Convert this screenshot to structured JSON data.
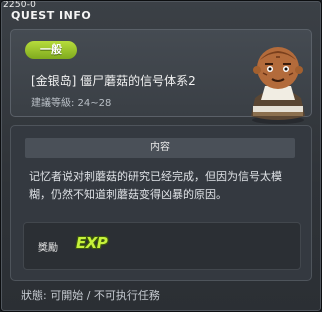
{
  "window": {
    "code": "2250-0",
    "title": "QUEST INFO"
  },
  "quest": {
    "category": "一般",
    "title": "[金银岛] 僵尸蘑菇的信号体系2",
    "level_range": "建議等級: 24~28",
    "npc_icon": "npc-portrait-icon"
  },
  "content": {
    "header": "内容",
    "description": "记忆者说对刺蘑菇的研究已经完成，但因为信号太模糊，仍然不知道刺蘑菇变得凶暴的原因。"
  },
  "reward": {
    "label": "獎勵",
    "exp_label": "EXP"
  },
  "status": {
    "text": "狀態: 可開始 / 不可执行任務"
  },
  "colors": {
    "category_badge": "#9cc82c",
    "exp": "#c6f23a",
    "background": "#2f3338"
  }
}
